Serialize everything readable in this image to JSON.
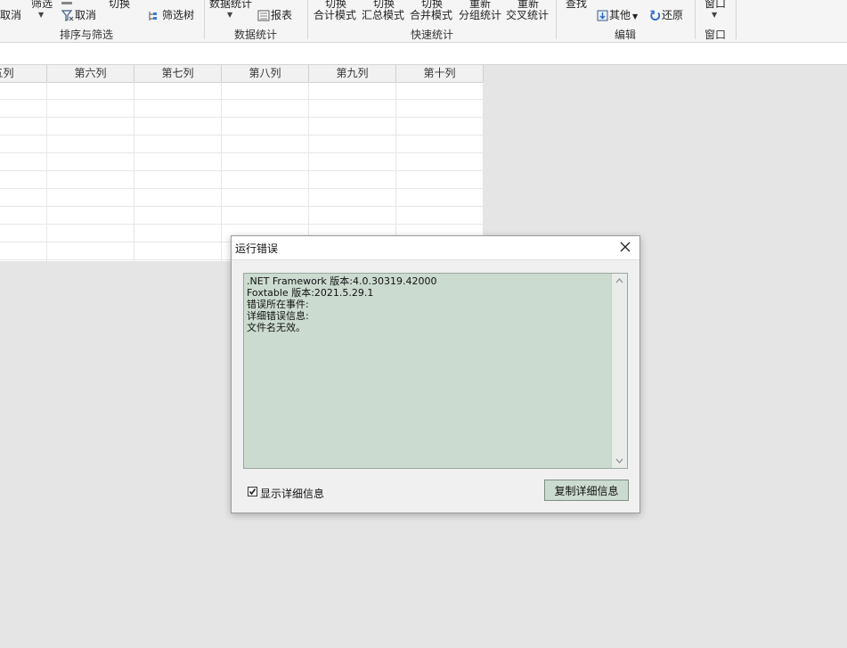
{
  "ribbon": {
    "groups": {
      "sort_filter": {
        "label": "排序与筛选",
        "items": {
          "cancel_left": "取消",
          "filter": "筛选",
          "cancel": "取消",
          "toggle": "切换",
          "filter_tree": "筛选树"
        }
      },
      "data_stats": {
        "label": "数据统计",
        "items": {
          "data_stats": "数据统计",
          "report": "报表"
        }
      },
      "quick_stats": {
        "label": "快速统计",
        "items": [
          {
            "top": "切换",
            "bottom": "合计模式"
          },
          {
            "top": "切换",
            "bottom": "汇总模式"
          },
          {
            "top": "切换",
            "bottom": "合并模式"
          },
          {
            "top": "重新",
            "bottom": "分组统计"
          },
          {
            "top": "重新",
            "bottom": "交叉统计"
          }
        ]
      },
      "edit": {
        "label": "编辑",
        "items": {
          "find": "查找",
          "other": "其他",
          "restore": "还原"
        }
      },
      "window": {
        "label": "窗口",
        "items": {
          "window": "窗口"
        }
      }
    }
  },
  "grid": {
    "columns": [
      "五列",
      "第六列",
      "第七列",
      "第八列",
      "第九列",
      "第十列"
    ]
  },
  "dialog": {
    "title": "运行错误",
    "lines": [
      ".NET Framework 版本:4.0.30319.42000",
      "Foxtable 版本:2021.5.29.1",
      "错误所在事件:",
      "详细错误信息:",
      "文件名无效。"
    ],
    "show_details_label": "显示详细信息",
    "show_details_checked": true,
    "copy_button_label": "复制详细信息"
  },
  "colors": {
    "dialog_text_bg": "#ccdbd0",
    "button_bg": "#ccdbd0",
    "workspace_bg": "#e5e5e6"
  }
}
